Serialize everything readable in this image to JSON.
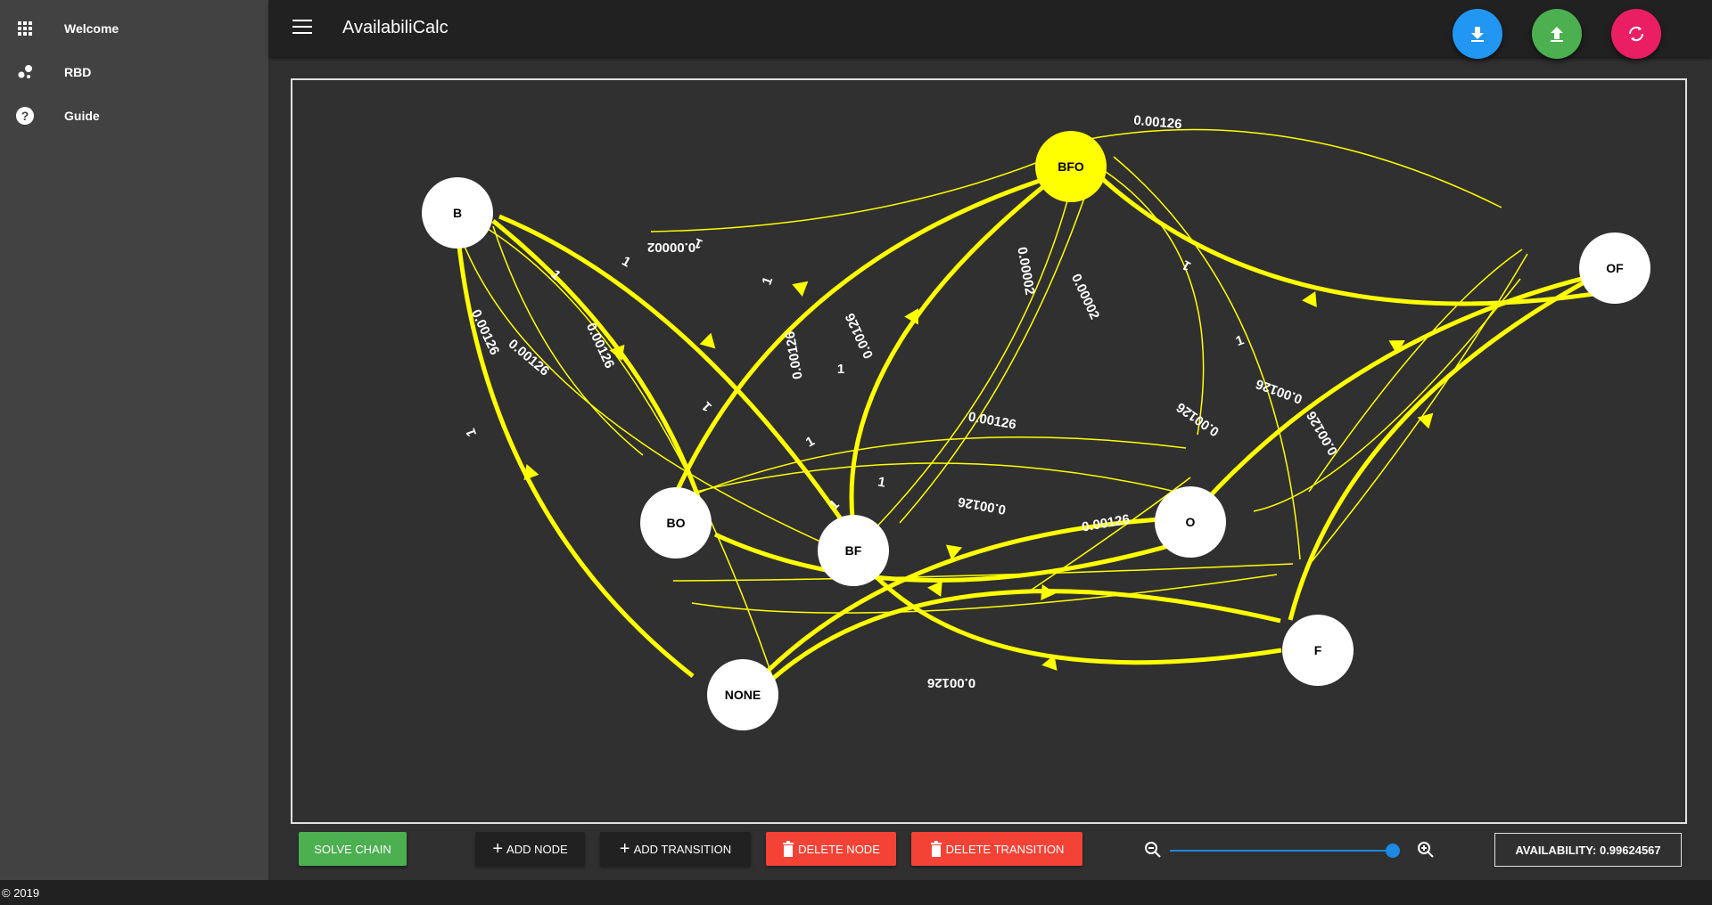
{
  "sidebar": {
    "items": [
      {
        "label": "Welcome",
        "icon": "apps-grid-icon"
      },
      {
        "label": "RBD",
        "icon": "bubble-chart-icon"
      },
      {
        "label": "Guide",
        "icon": "help-circle-icon"
      }
    ]
  },
  "appbar": {
    "title": "AvailabiliCalc"
  },
  "fabs": [
    {
      "name": "download-icon",
      "color": "#2196f3"
    },
    {
      "name": "upload-icon",
      "color": "#4caf50"
    },
    {
      "name": "reset-icon",
      "color": "#e91e63"
    }
  ],
  "graph": {
    "edge_color": "#ffff00",
    "highlight_node": "BFO",
    "nodes": [
      "B",
      "BFO",
      "OF",
      "BO",
      "BF",
      "O",
      "NONE",
      "F"
    ],
    "edge_labels": [
      "0.00126",
      "1",
      "0.00002",
      "1",
      "1",
      "0.00126",
      "1",
      "1",
      "0.00002",
      "0.00002",
      "0.00126",
      "0.00126",
      "1",
      "0.00126",
      "0.00126",
      "1",
      "0.00126",
      "0.00126",
      "1",
      "0.00126",
      "1",
      "1",
      "1",
      "0.00126",
      "1",
      "0.00126",
      "0.00126",
      "0.00126"
    ]
  },
  "toolbar": {
    "solve": "SOLVE CHAIN",
    "add_node": "ADD NODE",
    "add_transition": "ADD TRANSITION",
    "delete_node": "DELETE NODE",
    "delete_transition": "DELETE TRANSITION",
    "availability": "AVAILABILITY: 0.99624567"
  },
  "footer": {
    "copyright": "© 2019"
  }
}
